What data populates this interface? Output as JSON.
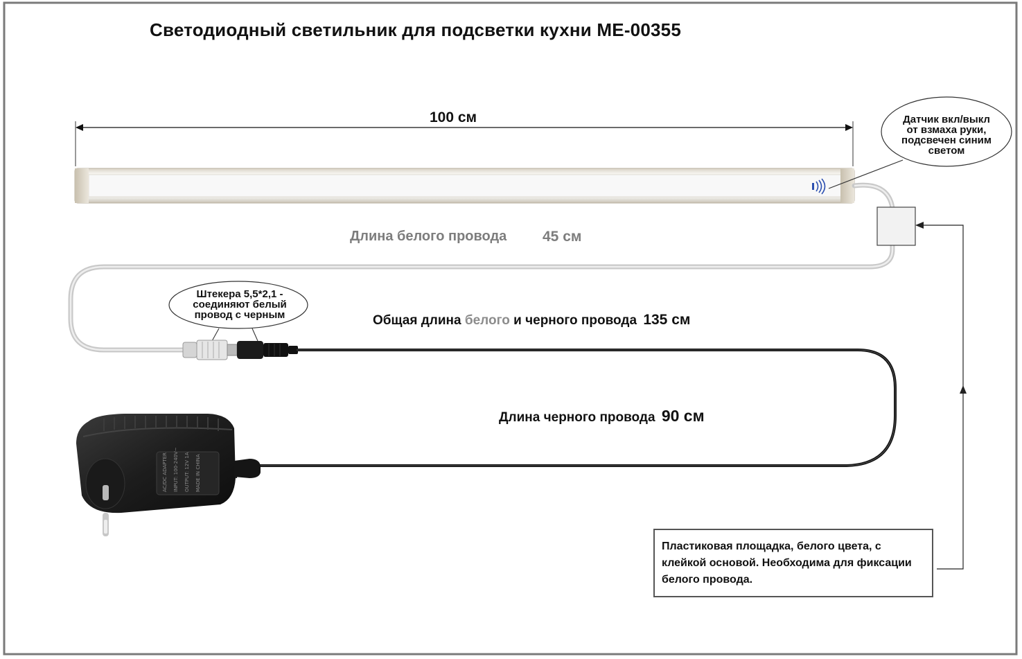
{
  "title": "Светодиодный светильник для подсветки кухни ME-00355",
  "dimension": {
    "length_label": "100 см"
  },
  "sensor_callout": {
    "lines": [
      "Датчик вкл/выкл",
      "от взмаха руки,",
      "подсвечен синим",
      "светом"
    ]
  },
  "white_wire": {
    "label": "Длина белого провода",
    "value": "45 см"
  },
  "plug_callout": {
    "lines": [
      "Штекера 5,5*2,1 -",
      "соединяют белый",
      "провод с черным"
    ]
  },
  "total_wire": {
    "prefix": "Общая длина",
    "white_word": "белого",
    "suffix": "и черного провода",
    "value": "135 см"
  },
  "black_wire": {
    "label": "Длина черного провода",
    "value": "90 см"
  },
  "note": {
    "text": " Пластиковая площадка, белого цвета, с клейкой основой. Необходима  для фиксации белого провода."
  },
  "adapter_label": {
    "lines": [
      "AC/DC ADAPTER",
      "INPUT: 100-240V~",
      "OUTPUT: 12V 1A",
      "MADE IN CHINA"
    ]
  },
  "colors": {
    "frame": "#777777",
    "white_wire": "#c9c9c9",
    "black_wire": "#111111",
    "sensor_blue": "#2b4fb0"
  }
}
